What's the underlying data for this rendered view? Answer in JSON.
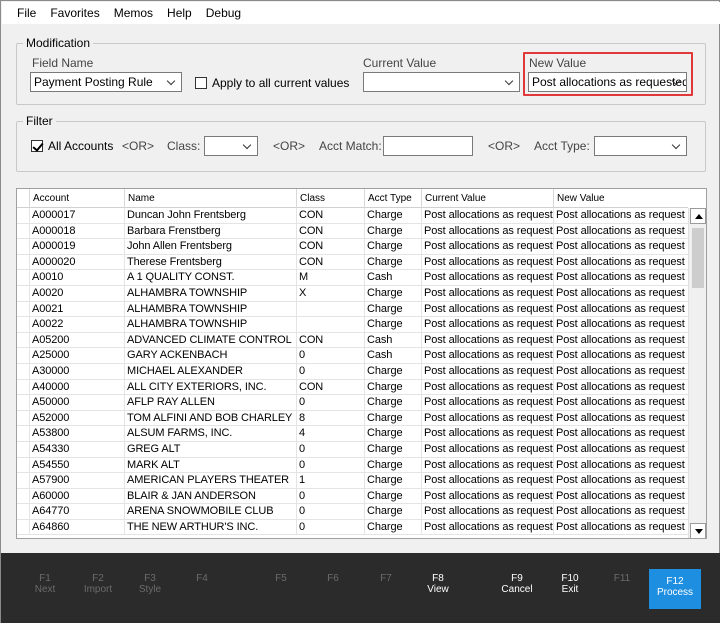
{
  "menu": [
    "File",
    "Favorites",
    "Memos",
    "Help",
    "Debug"
  ],
  "modification": {
    "legend": "Modification",
    "field_name_label": "Field Name",
    "field_name_value": "Payment Posting Rule",
    "apply_all_label": "Apply to all current values",
    "current_value_label": "Current Value",
    "current_value_value": "",
    "new_value_label": "New Value",
    "new_value_value": "Post allocations as requested"
  },
  "filter": {
    "legend": "Filter",
    "all_accounts_label": "All Accounts",
    "or1": "<OR>",
    "class_label": "Class:",
    "or2": "<OR>",
    "acct_match_label": "Acct Match:",
    "or3": "<OR>",
    "acct_type_label": "Acct Type:"
  },
  "grid": {
    "columns": [
      "Account",
      "Name",
      "Class",
      "Acct Type",
      "Current Value",
      "New Value"
    ],
    "rows": [
      [
        "A000017",
        "Duncan John Frentsberg",
        "CON",
        "Charge",
        "Post allocations as request",
        "Post allocations as request"
      ],
      [
        "A000018",
        "Barbara Frenstberg",
        "CON",
        "Charge",
        "Post allocations as request",
        "Post allocations as request"
      ],
      [
        "A000019",
        "John Allen Frentsberg",
        "CON",
        "Charge",
        "Post allocations as request",
        "Post allocations as request"
      ],
      [
        "A000020",
        "Therese Frentsberg",
        "CON",
        "Charge",
        "Post allocations as request",
        "Post allocations as request"
      ],
      [
        "A0010",
        "A 1 QUALITY CONST.",
        "M",
        "Cash",
        "Post allocations as request",
        "Post allocations as request"
      ],
      [
        "A0020",
        "ALHAMBRA TOWNSHIP",
        "X",
        "Charge",
        "Post allocations as request",
        "Post allocations as request"
      ],
      [
        "A0021",
        "ALHAMBRA TOWNSHIP",
        "",
        "Charge",
        "Post allocations as request",
        "Post allocations as request"
      ],
      [
        "A0022",
        "ALHAMBRA TOWNSHIP",
        "",
        "Charge",
        "Post allocations as request",
        "Post allocations as request"
      ],
      [
        "A05200",
        "ADVANCED CLIMATE CONTROL",
        "CON",
        "Cash",
        "Post allocations as request",
        "Post allocations as request"
      ],
      [
        "A25000",
        "GARY ACKENBACH",
        "0",
        "Cash",
        "Post allocations as request",
        "Post allocations as request"
      ],
      [
        "A30000",
        "MICHAEL ALEXANDER",
        "0",
        "Charge",
        "Post allocations as request",
        "Post allocations as request"
      ],
      [
        "A40000",
        "ALL CITY EXTERIORS, INC.",
        "CON",
        "Charge",
        "Post allocations as request",
        "Post allocations as request"
      ],
      [
        "A50000",
        "AFLP RAY ALLEN",
        "0",
        "Charge",
        "Post allocations as request",
        "Post allocations as request"
      ],
      [
        "A52000",
        "TOM ALFINI AND BOB CHARLEY",
        "8",
        "Charge",
        "Post allocations as request",
        "Post allocations as request"
      ],
      [
        "A53800",
        "ALSUM FARMS, INC.",
        "4",
        "Charge",
        "Post allocations as request",
        "Post allocations as request"
      ],
      [
        "A54330",
        "GREG ALT",
        "0",
        "Charge",
        "Post allocations as request",
        "Post allocations as request"
      ],
      [
        "A54550",
        "MARK ALT",
        "0",
        "Charge",
        "Post allocations as request",
        "Post allocations as request"
      ],
      [
        "A57900",
        "AMERICAN PLAYERS THEATER",
        "1",
        "Charge",
        "Post allocations as request",
        "Post allocations as request"
      ],
      [
        "A60000",
        "BLAIR & JAN ANDERSON",
        "0",
        "Charge",
        "Post allocations as request",
        "Post allocations as request"
      ],
      [
        "A64770",
        "ARENA SNOWMOBILE CLUB",
        "0",
        "Charge",
        "Post allocations as request",
        "Post allocations as request"
      ],
      [
        "A64860",
        "THE NEW ARTHUR'S INC.",
        "0",
        "Charge",
        "Post allocations as request",
        "Post allocations as request"
      ]
    ]
  },
  "fkeys": [
    {
      "key": "F1",
      "label": "Next",
      "enabled": false
    },
    {
      "key": "F2",
      "label": "Import",
      "enabled": false
    },
    {
      "key": "F3",
      "label": "Style",
      "enabled": false
    },
    {
      "key": "F4",
      "label": "",
      "enabled": false
    },
    {
      "key": "F5",
      "label": "",
      "enabled": false
    },
    {
      "key": "F6",
      "label": "",
      "enabled": false
    },
    {
      "key": "F7",
      "label": "",
      "enabled": false
    },
    {
      "key": "F8",
      "label": "View",
      "enabled": true
    },
    {
      "key": "F9",
      "label": "Cancel",
      "enabled": true
    },
    {
      "key": "F10",
      "label": "Exit",
      "enabled": true
    },
    {
      "key": "F11",
      "label": "",
      "enabled": false
    }
  ],
  "process_key": {
    "key": "F12",
    "label": "Process"
  },
  "colors": {
    "accent": "#1e8fe0",
    "highlight": "#e0383b",
    "fkeybar": "#2b2b2b"
  }
}
